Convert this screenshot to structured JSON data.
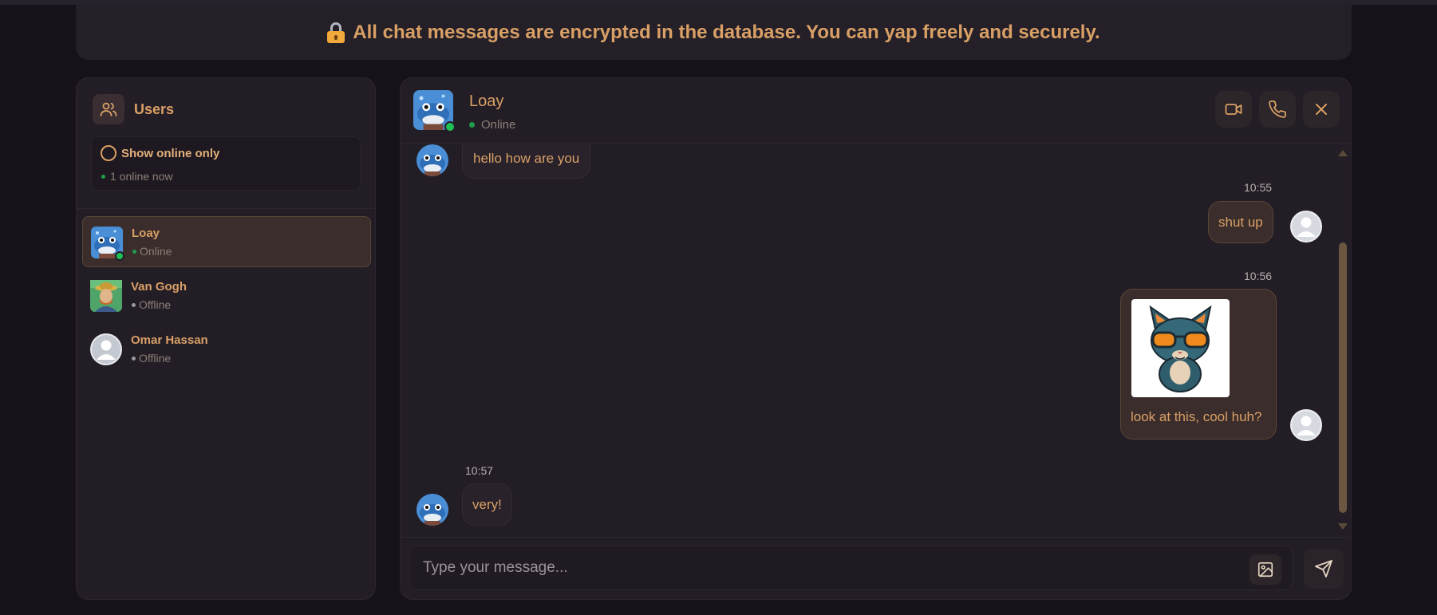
{
  "banner": {
    "text": "All chat messages are encrypted in the database. You can yap freely and securely."
  },
  "sidebar": {
    "title": "Users",
    "filter_label": "Show online only",
    "online_count": "1 online now",
    "users": [
      {
        "name": "Loay",
        "status": "Online",
        "active": true
      },
      {
        "name": "Van Gogh",
        "status": "Offline",
        "active": false
      },
      {
        "name": "Omar Hassan",
        "status": "Offline",
        "active": false
      }
    ]
  },
  "chat": {
    "name": "Loay",
    "status": "Online",
    "messages": [
      {
        "direction": "in",
        "text": "hello how are you"
      },
      {
        "direction": "out",
        "time": "10:55",
        "text": "shut up"
      },
      {
        "direction": "out",
        "time": "10:56",
        "text": "look at this, cool huh?",
        "has_image": true
      },
      {
        "direction": "in",
        "time": "10:57",
        "text": "very!"
      }
    ],
    "input_placeholder": "Type your message..."
  },
  "colors": {
    "accent": "#d9a066",
    "online": "#1fbf56",
    "background": "#171219",
    "panel": "#231d26"
  }
}
